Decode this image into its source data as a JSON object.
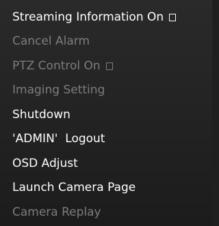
{
  "menu": {
    "items": [
      {
        "label": "Streaming Information On",
        "enabled": true,
        "checkbox": true
      },
      {
        "label": "Cancel Alarm",
        "enabled": false,
        "checkbox": false
      },
      {
        "label": "PTZ Control On",
        "enabled": false,
        "checkbox": true
      },
      {
        "label": "Imaging Setting",
        "enabled": false,
        "checkbox": false
      },
      {
        "label": "Shutdown",
        "enabled": true,
        "checkbox": false
      },
      {
        "label": "'ADMIN'  Logout",
        "enabled": true,
        "checkbox": false
      },
      {
        "label": "OSD Adjust",
        "enabled": true,
        "checkbox": false
      },
      {
        "label": "Launch Camera Page",
        "enabled": true,
        "checkbox": false
      },
      {
        "label": "Camera Replay",
        "enabled": false,
        "checkbox": false
      }
    ]
  },
  "colors": {
    "enabled_text": "#ffffff",
    "disabled_text": "#7d7d7d",
    "background": "#222222"
  }
}
